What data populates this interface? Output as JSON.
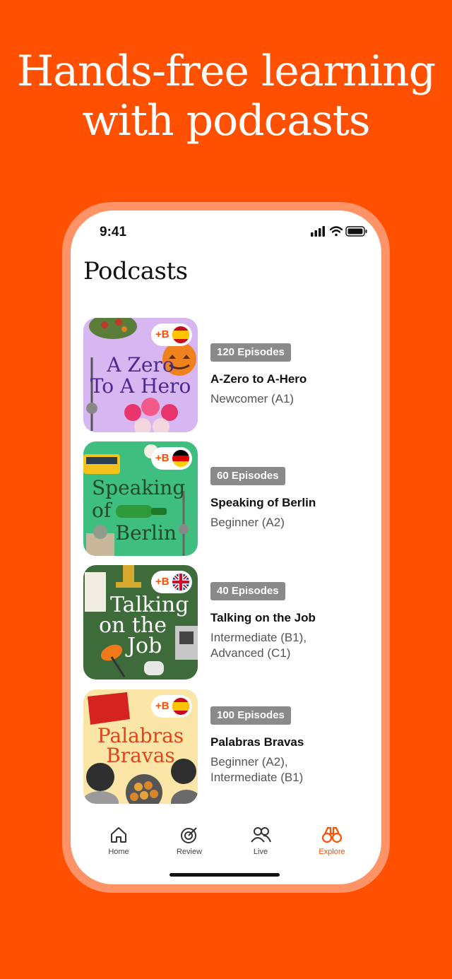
{
  "headline": {
    "line1": "Hands-free learning",
    "line2": "with podcasts"
  },
  "status_bar": {
    "time": "9:41",
    "icons": [
      "signal-icon",
      "wifi-icon",
      "battery-icon"
    ]
  },
  "page_title": "Podcasts",
  "podcasts": [
    {
      "cover_title_1": "A Zero",
      "cover_title_2": "To A Hero",
      "language": "Spanish",
      "pill": "+B",
      "episodes": "120 Episodes",
      "title": "A-Zero to A-Hero",
      "level": "Newcomer (A1)"
    },
    {
      "cover_title_1": "Speaking",
      "cover_title_2": "of",
      "cover_title_3": "Berlin",
      "language": "German",
      "pill": "+B",
      "episodes": "60 Episodes",
      "title": "Speaking of Berlin",
      "level": "Beginner (A2)"
    },
    {
      "cover_title_1": "Talking",
      "cover_title_2": "on the",
      "cover_title_3": "Job",
      "language": "English",
      "pill": "+B",
      "episodes": "40 Episodes",
      "title": "Talking on the Job",
      "level_1": "Intermediate (B1),",
      "level_2": "Advanced (C1)"
    },
    {
      "cover_title_1": "Palabras",
      "cover_title_2": "Bravas",
      "language": "Spanish",
      "pill": "+B",
      "episodes": "100 Episodes",
      "title": "Palabras Bravas",
      "level_1": "Beginner (A2),",
      "level_2": "Intermediate (B1)"
    }
  ],
  "tabs": [
    {
      "label": "Home",
      "icon": "home-icon",
      "active": false
    },
    {
      "label": "Review",
      "icon": "target-icon",
      "active": false
    },
    {
      "label": "Live",
      "icon": "people-icon",
      "active": false
    },
    {
      "label": "Explore",
      "icon": "binoculars-icon",
      "active": true
    }
  ],
  "colors": {
    "brand": "#FF4F00",
    "frame": "#FF9367",
    "badge": "#8a8a8a"
  }
}
